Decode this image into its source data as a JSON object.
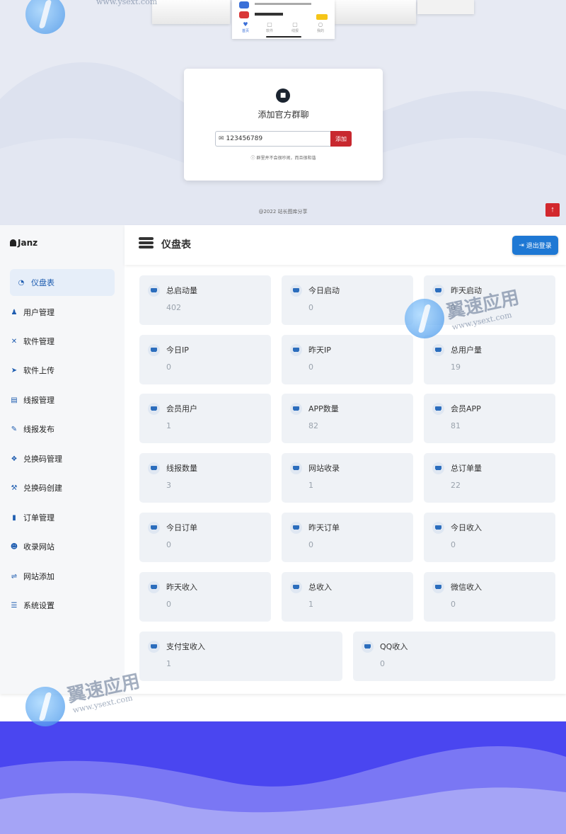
{
  "top": {
    "group_title": "添加官方群聊",
    "group_input_value": "123456789",
    "add_button": "添加",
    "group_note": "ⓘ 群里并不会很吵闹，而且很和谐",
    "footer": "@2022 站长图库分享",
    "phone_center_tabs": [
      "首页",
      "软件",
      "线报",
      "我的"
    ]
  },
  "sidebar": {
    "brand": "Janz",
    "items": [
      {
        "label": "仪盘表",
        "icon": "pie-chart-icon"
      },
      {
        "label": "用户管理",
        "icon": "user-icon"
      },
      {
        "label": "软件管理",
        "icon": "tools-icon"
      },
      {
        "label": "软件上传",
        "icon": "paper-plane-icon"
      },
      {
        "label": "线报管理",
        "icon": "list-icon"
      },
      {
        "label": "线报发布",
        "icon": "edit-icon"
      },
      {
        "label": "兑换码管理",
        "icon": "gift-icon"
      },
      {
        "label": "兑换码创建",
        "icon": "hammer-icon"
      },
      {
        "label": "订单管理",
        "icon": "scroll-icon"
      },
      {
        "label": "收录网站",
        "icon": "smile-icon"
      },
      {
        "label": "网站添加",
        "icon": "handshake-icon"
      },
      {
        "label": "系统设置",
        "icon": "sliders-icon"
      }
    ]
  },
  "header": {
    "title": "仪盘表",
    "logout": "退出登录"
  },
  "stats": [
    {
      "label": "总启动量",
      "value": "402"
    },
    {
      "label": "今日启动",
      "value": "0"
    },
    {
      "label": "昨天启动",
      "value": "0"
    },
    {
      "label": "今日IP",
      "value": "0"
    },
    {
      "label": "昨天IP",
      "value": "0"
    },
    {
      "label": "总用户量",
      "value": "19"
    },
    {
      "label": "会员用户",
      "value": "1"
    },
    {
      "label": "APP数量",
      "value": "82"
    },
    {
      "label": "会员APP",
      "value": "81"
    },
    {
      "label": "线报数量",
      "value": "3"
    },
    {
      "label": "网站收录",
      "value": "1"
    },
    {
      "label": "总订单量",
      "value": "22"
    },
    {
      "label": "今日订单",
      "value": "0"
    },
    {
      "label": "昨天订单",
      "value": "0"
    },
    {
      "label": "今日收入",
      "value": "0"
    },
    {
      "label": "昨天收入",
      "value": "0"
    },
    {
      "label": "总收入",
      "value": "1"
    },
    {
      "label": "微信收入",
      "value": "0"
    },
    {
      "label": "支付宝收入",
      "value": "1"
    },
    {
      "label": "QQ收入",
      "value": "0"
    }
  ],
  "watermark": {
    "text": "翼速应用",
    "url": "www.ysext.com"
  },
  "colors": {
    "accent": "#1e78d4",
    "danger": "#c8282f",
    "bottom_bg": "#4a46f0"
  }
}
